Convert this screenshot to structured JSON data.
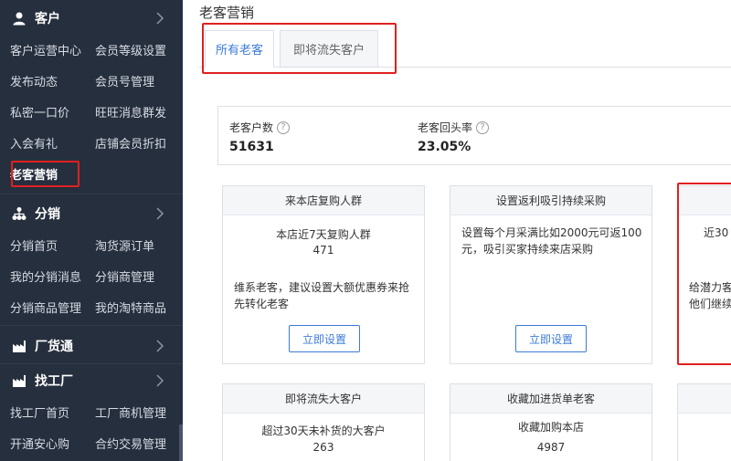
{
  "sidebar": {
    "sections": [
      {
        "title": "客户",
        "icon": "user-icon"
      },
      {
        "title": "分销",
        "icon": "sitemap-icon"
      },
      {
        "title": "厂货通",
        "icon": "factory-icon"
      },
      {
        "title": "找工厂",
        "icon": "factory-icon"
      }
    ],
    "customer_items": [
      "客户运营中心",
      "会员等级设置",
      "发布动态",
      "会员号管理",
      "私密一口价",
      "旺旺消息群发",
      "入会有礼",
      "店铺会员折扣",
      "老客营销"
    ],
    "distribution_items": [
      "分销首页",
      "淘货源订单",
      "我的分销消息",
      "分销商管理",
      "分销商品管理",
      "我的淘特商品"
    ],
    "factory_items": [
      "找工厂首页",
      "工厂商机管理",
      "开通安心购",
      "合约交易管理"
    ]
  },
  "main": {
    "title": "老客营销",
    "tabs": [
      "所有老客",
      "即将流失客户"
    ],
    "active_tab": "所有老客",
    "stats": [
      {
        "label": "老客户数",
        "value": "51631"
      },
      {
        "label": "老客回头率",
        "value": "23.05%"
      }
    ],
    "cards": [
      {
        "title": "来本店复购人群",
        "line1": "本店近7天复购人群",
        "line2": "471",
        "desc": "维系老客，建议设置大额优惠券来抢先转化老客",
        "button": "立即设置"
      },
      {
        "title": "设置返利吸引持续采购",
        "desc": "设置每个月采满比如2000元可返100元，吸引买家持续来店采购",
        "button": "立即设置"
      },
      {
        "title": "",
        "line1": "近30",
        "desc": "给潜力客他们继续"
      },
      {
        "title": "即将流失大客户",
        "line1": "超过30天未补货的大客户",
        "line2": "263"
      },
      {
        "title": "收藏加进货单老客",
        "line1": "收藏加购本店",
        "line2": "4987"
      },
      {
        "title": ""
      }
    ]
  },
  "colors": {
    "accent": "#3d7bd8",
    "sidebar_bg": "#262f3e",
    "highlight_box": "#e02020"
  }
}
